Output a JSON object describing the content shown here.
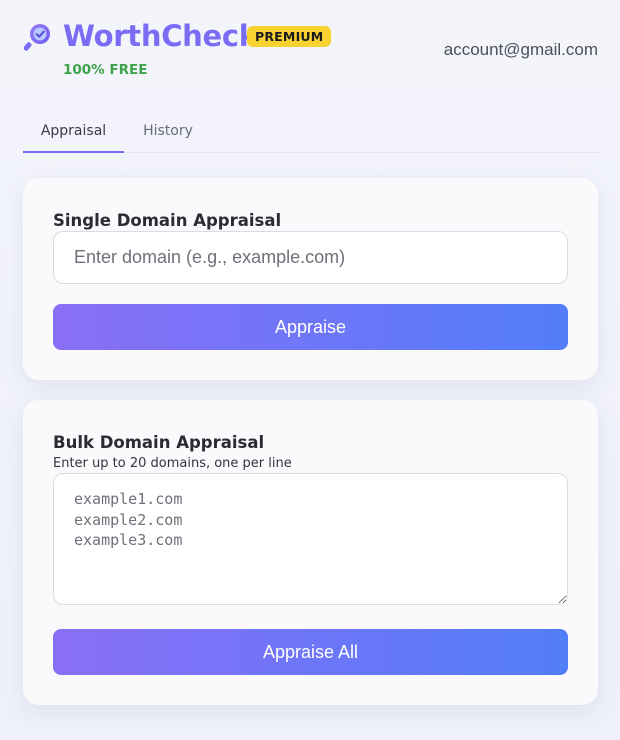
{
  "header": {
    "brand": "WorthCheck",
    "badge": "PREMIUM",
    "tagline": "100% FREE",
    "account": "account@gmail.com",
    "logo_icon": "magnifier-check-icon"
  },
  "tabs": [
    {
      "label": "Appraisal",
      "active": true
    },
    {
      "label": "History",
      "active": false
    }
  ],
  "single": {
    "title": "Single Domain Appraisal",
    "placeholder": "Enter domain (e.g., example.com)",
    "button": "Appraise"
  },
  "bulk": {
    "title": "Bulk Domain Appraisal",
    "subtitle": "Enter up to 20 domains, one per line",
    "placeholder": "example1.com\nexample2.com\nexample3.com",
    "button": "Appraise All"
  },
  "colors": {
    "brand": "#7b6cf6",
    "badge": "#f7d230",
    "free": "#3da34a",
    "button_start": "#8a6ff6",
    "button_end": "#527df9"
  }
}
